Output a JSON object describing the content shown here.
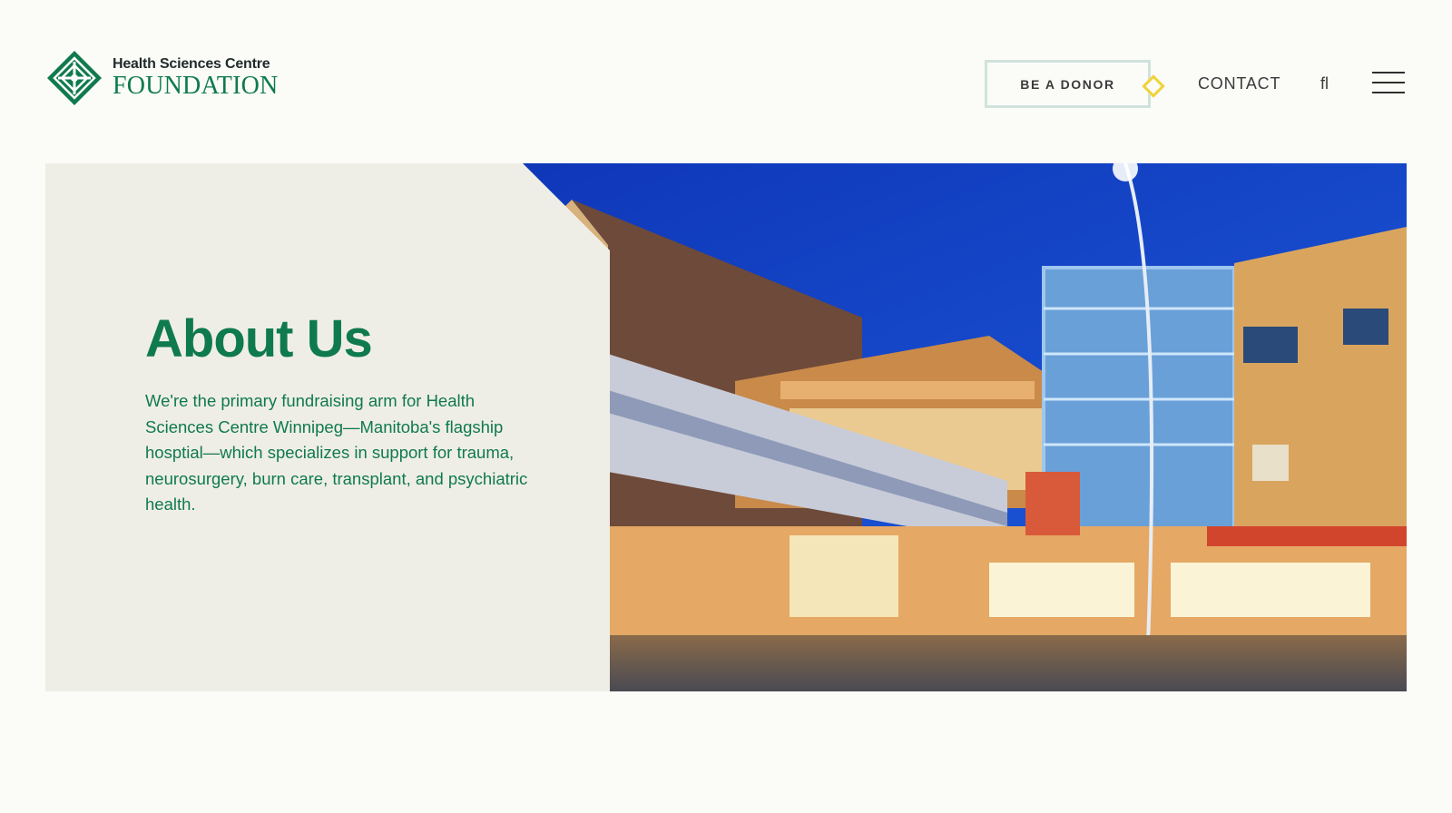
{
  "header": {
    "logo_line1": "Health Sciences Centre",
    "logo_line2": "FOUNDATION",
    "donor_label": "BE A DONOR",
    "contact_label": "CONTACT",
    "search_glyph": "fl",
    "menu_icon": "hamburger-menu-icon"
  },
  "hero": {
    "title": "About Us",
    "description": "We're the primary fundraising arm for Health Sciences Centre Winnipeg—Manitoba's flagship hosptial—which specializes in support for trauma, neurosurgery, burn care, transplant, and psychiatric health.",
    "photo_icon": "hospital-building-photo"
  },
  "colors": {
    "brand_green": "#0f7a4c",
    "panel_beige": "#efeee6",
    "accent_yellow": "#f0d33a",
    "button_border": "#cfe3dc"
  }
}
